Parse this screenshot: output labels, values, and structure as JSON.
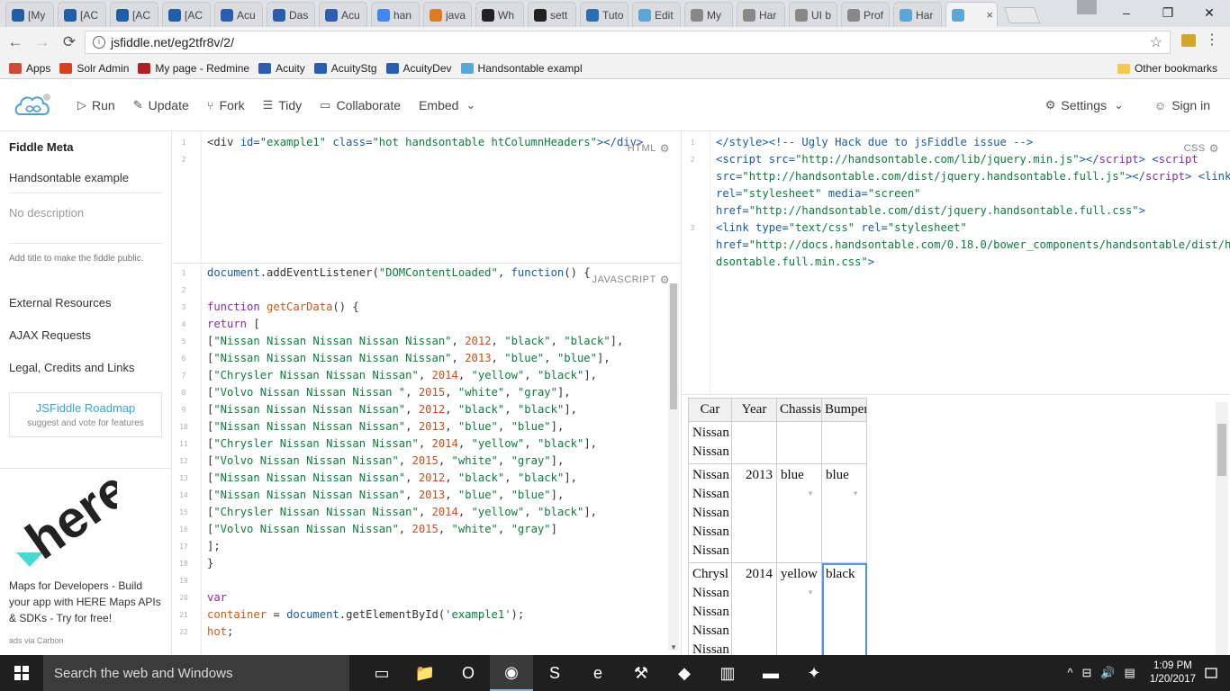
{
  "browser": {
    "tabs": [
      {
        "icon": "pinwheel-icon",
        "color": "#1e5fa8",
        "label": "[My"
      },
      {
        "icon": "pinwheel-icon",
        "color": "#1e5fa8",
        "label": "[AC"
      },
      {
        "icon": "pinwheel-icon",
        "color": "#1e5fa8",
        "label": "[AC"
      },
      {
        "icon": "pinwheel-icon",
        "color": "#1e5fa8",
        "label": "[AC"
      },
      {
        "icon": "acuity-icon",
        "color": "#2a5db0",
        "label": "Acu"
      },
      {
        "icon": "acuity-icon",
        "color": "#2a5db0",
        "label": "Das"
      },
      {
        "icon": "acuity-icon",
        "color": "#2a5db0",
        "label": "Acu"
      },
      {
        "icon": "google-icon",
        "color": "#4285f4",
        "label": "han"
      },
      {
        "icon": "java-icon",
        "color": "#e07b22",
        "label": "java"
      },
      {
        "icon": "github-icon",
        "color": "#222222",
        "label": "Wh"
      },
      {
        "icon": "github-icon",
        "color": "#222222",
        "label": "sett"
      },
      {
        "icon": "h-icon",
        "color": "#2a6fb0",
        "label": "Tuto"
      },
      {
        "icon": "jsfiddle-icon",
        "color": "#5aa6d6",
        "label": "Edit"
      },
      {
        "icon": "hex-icon",
        "color": "#888888",
        "label": "My"
      },
      {
        "icon": "hex-icon",
        "color": "#888888",
        "label": "Har"
      },
      {
        "icon": "hex-icon",
        "color": "#888888",
        "label": "UI b"
      },
      {
        "icon": "hex-icon",
        "color": "#888888",
        "label": "Prof"
      },
      {
        "icon": "jsfiddle-icon",
        "color": "#5aa6d6",
        "label": "Har"
      },
      {
        "icon": "jsfiddle-icon",
        "color": "#5aa6d6",
        "label": "",
        "active": true
      }
    ],
    "close_glyph": "×",
    "window_controls": [
      "–",
      "❐",
      "✕"
    ],
    "url": "jsfiddle.net/eg2tfr8v/2/",
    "bookmarks": [
      {
        "label": "Apps",
        "icon": "apps-grid-icon",
        "color": "#d04a3a"
      },
      {
        "label": "Solr Admin",
        "icon": "solr-icon",
        "color": "#d9411e"
      },
      {
        "label": "My page - Redmine",
        "icon": "redmine-icon",
        "color": "#b32024"
      },
      {
        "label": "Acuity",
        "icon": "acuity-icon",
        "color": "#2a5db0"
      },
      {
        "label": "AcuityStg",
        "icon": "acuity-icon",
        "color": "#2a5db0"
      },
      {
        "label": "AcuityDev",
        "icon": "acuity-icon",
        "color": "#2a5db0"
      },
      {
        "label": "Handsontable exampl",
        "icon": "jsfiddle-icon",
        "color": "#5aa6d6"
      }
    ],
    "other_bookmarks": "Other bookmarks"
  },
  "fiddle": {
    "actions": [
      {
        "label": "Run",
        "icon": "play-icon",
        "glyph": "▷"
      },
      {
        "label": "Update",
        "icon": "pencil-icon",
        "glyph": "✎"
      },
      {
        "label": "Fork",
        "icon": "fork-icon",
        "glyph": "⑂"
      },
      {
        "label": "Tidy",
        "icon": "tidy-icon",
        "glyph": "☰"
      },
      {
        "label": "Collaborate",
        "icon": "chat-icon",
        "glyph": "▭"
      },
      {
        "label": "Embed",
        "icon": "chevron-down-icon",
        "glyph": "⌄"
      }
    ],
    "settings": "Settings",
    "sign_in": "Sign in"
  },
  "sidebar": {
    "title": "Fiddle Meta",
    "name": "Handsontable example",
    "description_placeholder": "No description",
    "hint": "Add title to make the fiddle public.",
    "links": [
      "External Resources",
      "AJAX Requests",
      "Legal, Credits and Links"
    ],
    "roadmap_title": "JSFiddle Roadmap",
    "roadmap_sub": "suggest and vote for features",
    "ad_text": "Maps for Developers - Build your app with HERE Maps APIs & SDKs - Try for free!",
    "ad_via": "ads via Carbon"
  },
  "panels": {
    "html_label": "HTML",
    "js_label": "JAVASCRIPT",
    "css_label": "CSS",
    "html_lines": [
      [
        {
          "t": "<div ",
          "c": "plain"
        },
        {
          "t": "id=",
          "c": "codetag"
        },
        {
          "t": "\"example1\"",
          "c": "str"
        },
        {
          "t": " class=",
          "c": "codetag"
        },
        {
          "t": "\"hot handsontable htColumnHeaders\"",
          "c": "str"
        },
        {
          "t": "></div>",
          "c": "codetag"
        }
      ],
      []
    ],
    "js_lines": [
      [
        {
          "t": "document",
          "c": "codetag"
        },
        {
          "t": ".addEventListener(",
          "c": "plain"
        },
        {
          "t": "\"DOMContentLoaded\"",
          "c": "str"
        },
        {
          "t": ", ",
          "c": "plain"
        },
        {
          "t": "function",
          "c": "codetag"
        },
        {
          "t": "() {",
          "c": "plain"
        }
      ],
      [],
      [
        {
          "t": "  function ",
          "c": "kw"
        },
        {
          "t": "getCarData",
          "c": "fn"
        },
        {
          "t": "() {",
          "c": "plain"
        }
      ],
      [
        {
          "t": "    return ",
          "c": "kw"
        },
        {
          "t": "[",
          "c": "plain"
        }
      ],
      [
        {
          "t": "      [",
          "c": "plain"
        },
        {
          "t": "\"Nissan Nissan Nissan Nissan Nissan\"",
          "c": "str"
        },
        {
          "t": ", ",
          "c": "plain"
        },
        {
          "t": "2012",
          "c": "num"
        },
        {
          "t": ", ",
          "c": "plain"
        },
        {
          "t": "\"black\"",
          "c": "str"
        },
        {
          "t": ", ",
          "c": "plain"
        },
        {
          "t": "\"black\"",
          "c": "str"
        },
        {
          "t": "],",
          "c": "plain"
        }
      ],
      [
        {
          "t": "      [",
          "c": "plain"
        },
        {
          "t": "\"Nissan Nissan Nissan Nissan Nissan\"",
          "c": "str"
        },
        {
          "t": ", ",
          "c": "plain"
        },
        {
          "t": "2013",
          "c": "num"
        },
        {
          "t": ", ",
          "c": "plain"
        },
        {
          "t": "\"blue\"",
          "c": "str"
        },
        {
          "t": ", ",
          "c": "plain"
        },
        {
          "t": "\"blue\"",
          "c": "str"
        },
        {
          "t": "],",
          "c": "plain"
        }
      ],
      [
        {
          "t": "      [",
          "c": "plain"
        },
        {
          "t": "\"Chrysler Nissan Nissan Nissan\"",
          "c": "str"
        },
        {
          "t": ", ",
          "c": "plain"
        },
        {
          "t": "2014",
          "c": "num"
        },
        {
          "t": ", ",
          "c": "plain"
        },
        {
          "t": "\"yellow\"",
          "c": "str"
        },
        {
          "t": ", ",
          "c": "plain"
        },
        {
          "t": "\"black\"",
          "c": "str"
        },
        {
          "t": "],",
          "c": "plain"
        }
      ],
      [
        {
          "t": "      [",
          "c": "plain"
        },
        {
          "t": "\"Volvo Nissan Nissan Nissan \"",
          "c": "str"
        },
        {
          "t": ", ",
          "c": "plain"
        },
        {
          "t": "2015",
          "c": "num"
        },
        {
          "t": ", ",
          "c": "plain"
        },
        {
          "t": "\"white\"",
          "c": "str"
        },
        {
          "t": ", ",
          "c": "plain"
        },
        {
          "t": "\"gray\"",
          "c": "str"
        },
        {
          "t": "],",
          "c": "plain"
        }
      ],
      [
        {
          "t": "      [",
          "c": "plain"
        },
        {
          "t": "\"Nissan Nissan Nissan Nissan\"",
          "c": "str"
        },
        {
          "t": ", ",
          "c": "plain"
        },
        {
          "t": "2012",
          "c": "num"
        },
        {
          "t": ", ",
          "c": "plain"
        },
        {
          "t": "\"black\"",
          "c": "str"
        },
        {
          "t": ", ",
          "c": "plain"
        },
        {
          "t": "\"black\"",
          "c": "str"
        },
        {
          "t": "],",
          "c": "plain"
        }
      ],
      [
        {
          "t": "      [",
          "c": "plain"
        },
        {
          "t": "\"Nissan Nissan Nissan Nissan\"",
          "c": "str"
        },
        {
          "t": ", ",
          "c": "plain"
        },
        {
          "t": "2013",
          "c": "num"
        },
        {
          "t": ", ",
          "c": "plain"
        },
        {
          "t": "\"blue\"",
          "c": "str"
        },
        {
          "t": ", ",
          "c": "plain"
        },
        {
          "t": "\"blue\"",
          "c": "str"
        },
        {
          "t": "],",
          "c": "plain"
        }
      ],
      [
        {
          "t": "      [",
          "c": "plain"
        },
        {
          "t": "\"Chrysler Nissan Nissan Nissan\"",
          "c": "str"
        },
        {
          "t": ", ",
          "c": "plain"
        },
        {
          "t": "2014",
          "c": "num"
        },
        {
          "t": ", ",
          "c": "plain"
        },
        {
          "t": "\"yellow\"",
          "c": "str"
        },
        {
          "t": ", ",
          "c": "plain"
        },
        {
          "t": "\"black\"",
          "c": "str"
        },
        {
          "t": "],",
          "c": "plain"
        }
      ],
      [
        {
          "t": "      [",
          "c": "plain"
        },
        {
          "t": "\"Volvo Nissan Nissan Nissan\"",
          "c": "str"
        },
        {
          "t": ", ",
          "c": "plain"
        },
        {
          "t": "2015",
          "c": "num"
        },
        {
          "t": ", ",
          "c": "plain"
        },
        {
          "t": "\"white\"",
          "c": "str"
        },
        {
          "t": ", ",
          "c": "plain"
        },
        {
          "t": "\"gray\"",
          "c": "str"
        },
        {
          "t": "],",
          "c": "plain"
        }
      ],
      [
        {
          "t": "      [",
          "c": "plain"
        },
        {
          "t": "\"Nissan Nissan Nissan Nissan\"",
          "c": "str"
        },
        {
          "t": ", ",
          "c": "plain"
        },
        {
          "t": "2012",
          "c": "num"
        },
        {
          "t": ", ",
          "c": "plain"
        },
        {
          "t": "\"black\"",
          "c": "str"
        },
        {
          "t": ", ",
          "c": "plain"
        },
        {
          "t": "\"black\"",
          "c": "str"
        },
        {
          "t": "],",
          "c": "plain"
        }
      ],
      [
        {
          "t": "      [",
          "c": "plain"
        },
        {
          "t": "\"Nissan Nissan Nissan Nissan\"",
          "c": "str"
        },
        {
          "t": ", ",
          "c": "plain"
        },
        {
          "t": "2013",
          "c": "num"
        },
        {
          "t": ", ",
          "c": "plain"
        },
        {
          "t": "\"blue\"",
          "c": "str"
        },
        {
          "t": ", ",
          "c": "plain"
        },
        {
          "t": "\"blue\"",
          "c": "str"
        },
        {
          "t": "],",
          "c": "plain"
        }
      ],
      [
        {
          "t": "      [",
          "c": "plain"
        },
        {
          "t": "\"Chrysler Nissan Nissan Nissan\"",
          "c": "str"
        },
        {
          "t": ", ",
          "c": "plain"
        },
        {
          "t": "2014",
          "c": "num"
        },
        {
          "t": ", ",
          "c": "plain"
        },
        {
          "t": "\"yellow\"",
          "c": "str"
        },
        {
          "t": ", ",
          "c": "plain"
        },
        {
          "t": "\"black\"",
          "c": "str"
        },
        {
          "t": "],",
          "c": "plain"
        }
      ],
      [
        {
          "t": "      [",
          "c": "plain"
        },
        {
          "t": "\"Volvo Nissan Nissan Nissan\"",
          "c": "str"
        },
        {
          "t": ", ",
          "c": "plain"
        },
        {
          "t": "2015",
          "c": "num"
        },
        {
          "t": ", ",
          "c": "plain"
        },
        {
          "t": "\"white\"",
          "c": "str"
        },
        {
          "t": ", ",
          "c": "plain"
        },
        {
          "t": "\"gray\"",
          "c": "str"
        },
        {
          "t": "]",
          "c": "plain"
        }
      ],
      [
        {
          "t": "    ];",
          "c": "plain"
        }
      ],
      [
        {
          "t": "  }",
          "c": "plain"
        }
      ],
      [],
      [
        {
          "t": "  var",
          "c": "kw"
        }
      ],
      [
        {
          "t": "    container",
          "c": "fn"
        },
        {
          "t": " = ",
          "c": "plain"
        },
        {
          "t": "document",
          "c": "codetag"
        },
        {
          "t": ".getElementById(",
          "c": "plain"
        },
        {
          "t": "'example1'",
          "c": "str"
        },
        {
          "t": ");",
          "c": "plain"
        }
      ],
      [
        {
          "t": "    hot",
          "c": "fn"
        },
        {
          "t": ";",
          "c": "plain"
        }
      ]
    ],
    "css_lines": [
      [
        {
          "t": "</style>",
          "c": "codetag"
        },
        {
          "t": "<!-- Ugly Hack due to jsFiddle issue -->",
          "c": "codetag"
        }
      ],
      [
        {
          "t": "<script ",
          "c": "codetag"
        },
        {
          "t": "src=",
          "c": "codetag"
        },
        {
          "t": "\"http://handsontable.com/lib/jquery.min.js\"",
          "c": "str"
        },
        {
          "t": "></",
          "c": "codetag"
        },
        {
          "t": "script",
          "c": "kw"
        },
        {
          "t": "> <",
          "c": "codetag"
        },
        {
          "t": "script",
          "c": "kw"
        }
      ],
      [
        {
          "t": "src=",
          "c": "codetag"
        },
        {
          "t": "\"http://handsontable.com/dist/jquery.handsontable.full.js\"",
          "c": "str"
        },
        {
          "t": "></",
          "c": "codetag"
        },
        {
          "t": "script",
          "c": "kw"
        },
        {
          "t": "> <link",
          "c": "codetag"
        }
      ],
      [
        {
          "t": "rel=",
          "c": "codetag"
        },
        {
          "t": "\"stylesheet\"",
          "c": "str"
        },
        {
          "t": " media=",
          "c": "codetag"
        },
        {
          "t": "\"screen\"",
          "c": "str"
        }
      ],
      [
        {
          "t": "href=",
          "c": "codetag"
        },
        {
          "t": "\"http://handsontable.com/dist/jquery.handsontable.full.css\"",
          "c": "str"
        },
        {
          "t": ">",
          "c": "codetag"
        }
      ],
      [
        {
          "t": "<link ",
          "c": "codetag"
        },
        {
          "t": "type=",
          "c": "codetag"
        },
        {
          "t": "\"text/css\"",
          "c": "str"
        },
        {
          "t": " rel=",
          "c": "codetag"
        },
        {
          "t": "\"stylesheet\"",
          "c": "str"
        }
      ],
      [
        {
          "t": "href=",
          "c": "codetag"
        },
        {
          "t": "\"http://docs.handsontable.com/0.18.0/bower_components/handsontable/dist/han",
          "c": "str"
        }
      ],
      [
        {
          "t": "dsontable.full.min.css\"",
          "c": "str"
        },
        {
          "t": ">",
          "c": "codetag"
        }
      ]
    ],
    "css_line_numbers": [
      "1",
      "2",
      "",
      "",
      "",
      "3",
      "",
      ""
    ]
  },
  "result_table": {
    "headers": [
      "Car",
      "Year",
      "Chassis",
      "Bumper"
    ],
    "rows": [
      {
        "car": "Nissan\nNissan",
        "year": "",
        "chassis": "",
        "bumper": "",
        "arrows": false
      },
      {
        "car": "Nissan\nNissan\nNissan\nNissan\nNissan",
        "year": "2013",
        "chassis": "blue",
        "bumper": "blue",
        "arrows": true
      },
      {
        "car": "Chrysl\nNissan\nNissan\nNissan\nNissan",
        "year": "2014",
        "chassis": "yellow",
        "bumper": "black",
        "arrows": true,
        "selected_col": "bumper"
      }
    ],
    "arrow_glyph": "▼"
  },
  "taskbar": {
    "search_placeholder": "Search the web and Windows",
    "apps": [
      {
        "icon": "task-view-icon",
        "glyph": "▭"
      },
      {
        "icon": "file-explorer-icon",
        "glyph": "📁"
      },
      {
        "icon": "outlook-icon",
        "glyph": "O"
      },
      {
        "icon": "chrome-icon",
        "glyph": "◉",
        "active": true
      },
      {
        "icon": "skype-icon",
        "glyph": "S"
      },
      {
        "icon": "edge-icon",
        "glyph": "e"
      },
      {
        "icon": "tools-icon",
        "glyph": "⚒"
      },
      {
        "icon": "visual-studio-icon",
        "glyph": "◆"
      },
      {
        "icon": "chart-app-icon",
        "glyph": "▥"
      },
      {
        "icon": "cmd-icon",
        "glyph": "▬"
      },
      {
        "icon": "puzzle-icon",
        "glyph": "✦"
      }
    ],
    "tray_icons": [
      "^",
      "⊟",
      "🔊",
      "▤"
    ],
    "time": "1:09 PM",
    "date": "1/20/2017"
  }
}
